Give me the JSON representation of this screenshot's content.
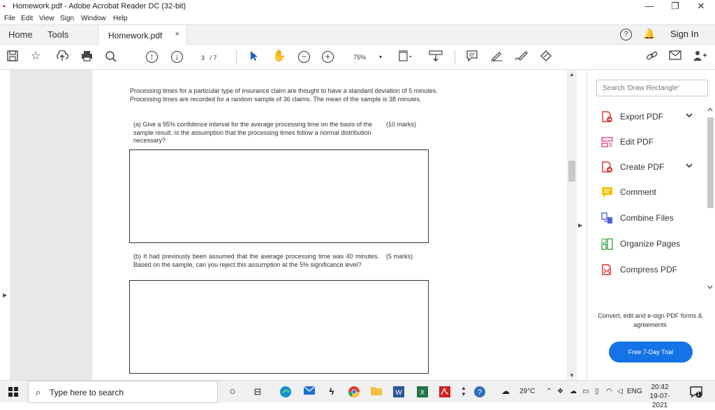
{
  "window": {
    "title": "Homework.pdf - Adobe Acrobat Reader DC (32-bit)",
    "minimize": "—",
    "restore": "❐",
    "close": "✕"
  },
  "menu": [
    "File",
    "Edit",
    "View",
    "Sign",
    "Window",
    "Help"
  ],
  "tabs": {
    "home": "Home",
    "tools": "Tools",
    "document": "Homework.pdf",
    "close": "×"
  },
  "header": {
    "help": "?",
    "sign_in": "Sign In"
  },
  "toolbar": {
    "page_current": "3",
    "page_total": "/ 7",
    "zoom": "75%",
    "zoom_arrow": "▾"
  },
  "document": {
    "intro": "Processing times for a particular type of insurance claim are thought to have a standard deviation of 5 minutes. Processing times are recorded for a random sample of 36 claims. The mean of the sample is 38 minutes.",
    "qa_text": "(a) Give a 95% confidence interval for the average processing time on the basis of the sample result. Is the assumption that the processing times follow a normal distribution necessary?",
    "qa_marks": "(10 marks)",
    "qb_text": "(b) It had previously been assumed that the average processing time was 40 minutes. Based on the sample, can you reject this assumption at the 5% significance level?",
    "qb_marks": "(5 marks)"
  },
  "right_panel": {
    "search_placeholder": "Search 'Draw Rectangle'",
    "tools": [
      {
        "label": "Export PDF",
        "icon": "export-pdf-icon",
        "color": "#d9322d",
        "has_expand": true
      },
      {
        "label": "Edit PDF",
        "icon": "edit-pdf-icon",
        "color": "#e04a8b",
        "has_expand": false
      },
      {
        "label": "Create PDF",
        "icon": "create-pdf-icon",
        "color": "#d9322d",
        "has_expand": true
      },
      {
        "label": "Comment",
        "icon": "comment-icon",
        "color": "#f5c400",
        "has_expand": false
      },
      {
        "label": "Combine Files",
        "icon": "combine-files-icon",
        "color": "#4b63d8",
        "has_expand": false
      },
      {
        "label": "Organize Pages",
        "icon": "organize-pages-icon",
        "color": "#3aa34a",
        "has_expand": false
      },
      {
        "label": "Compress PDF",
        "icon": "compress-pdf-icon",
        "color": "#d9322d",
        "has_expand": false
      }
    ],
    "promo_text": "Convert, edit and e-sign PDF forms & agreements",
    "trial_button": "Free 7-Day Trial"
  },
  "taskbar": {
    "search_placeholder": "Type here to search",
    "weather": "29°C",
    "language": "ENG",
    "time": "20:42",
    "date": "19-07-2021",
    "notification_count": "1"
  },
  "colors": {
    "accent": "#1473e6",
    "brand": "#d11f1f"
  }
}
